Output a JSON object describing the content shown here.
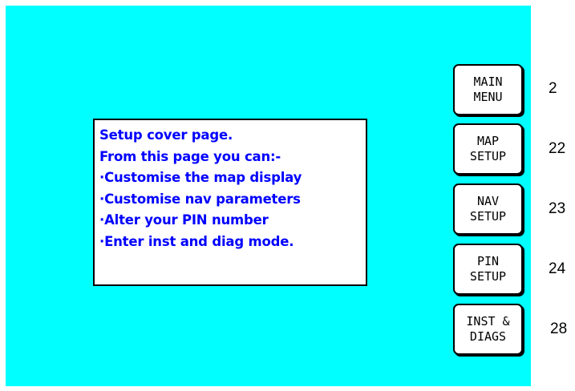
{
  "info": {
    "lines": [
      "Setup cover page.",
      "From this page you can:-",
      "·Customise the map display",
      "·Customise nav parameters",
      "·Alter your PIN number",
      "·Enter inst and diag mode."
    ]
  },
  "buttons": [
    {
      "line1": "MAIN",
      "line2": "MENU",
      "page": "2"
    },
    {
      "line1": "MAP",
      "line2": "SETUP",
      "page": "22"
    },
    {
      "line1": "NAV",
      "line2": "SETUP",
      "page": "23"
    },
    {
      "line1": "PIN",
      "line2": "SETUP",
      "page": "24"
    },
    {
      "line1": "INST &",
      "line2": "DIAGS",
      "page": "28"
    }
  ],
  "colors": {
    "screen_background": "#00ffff",
    "text": "#0000ff"
  }
}
